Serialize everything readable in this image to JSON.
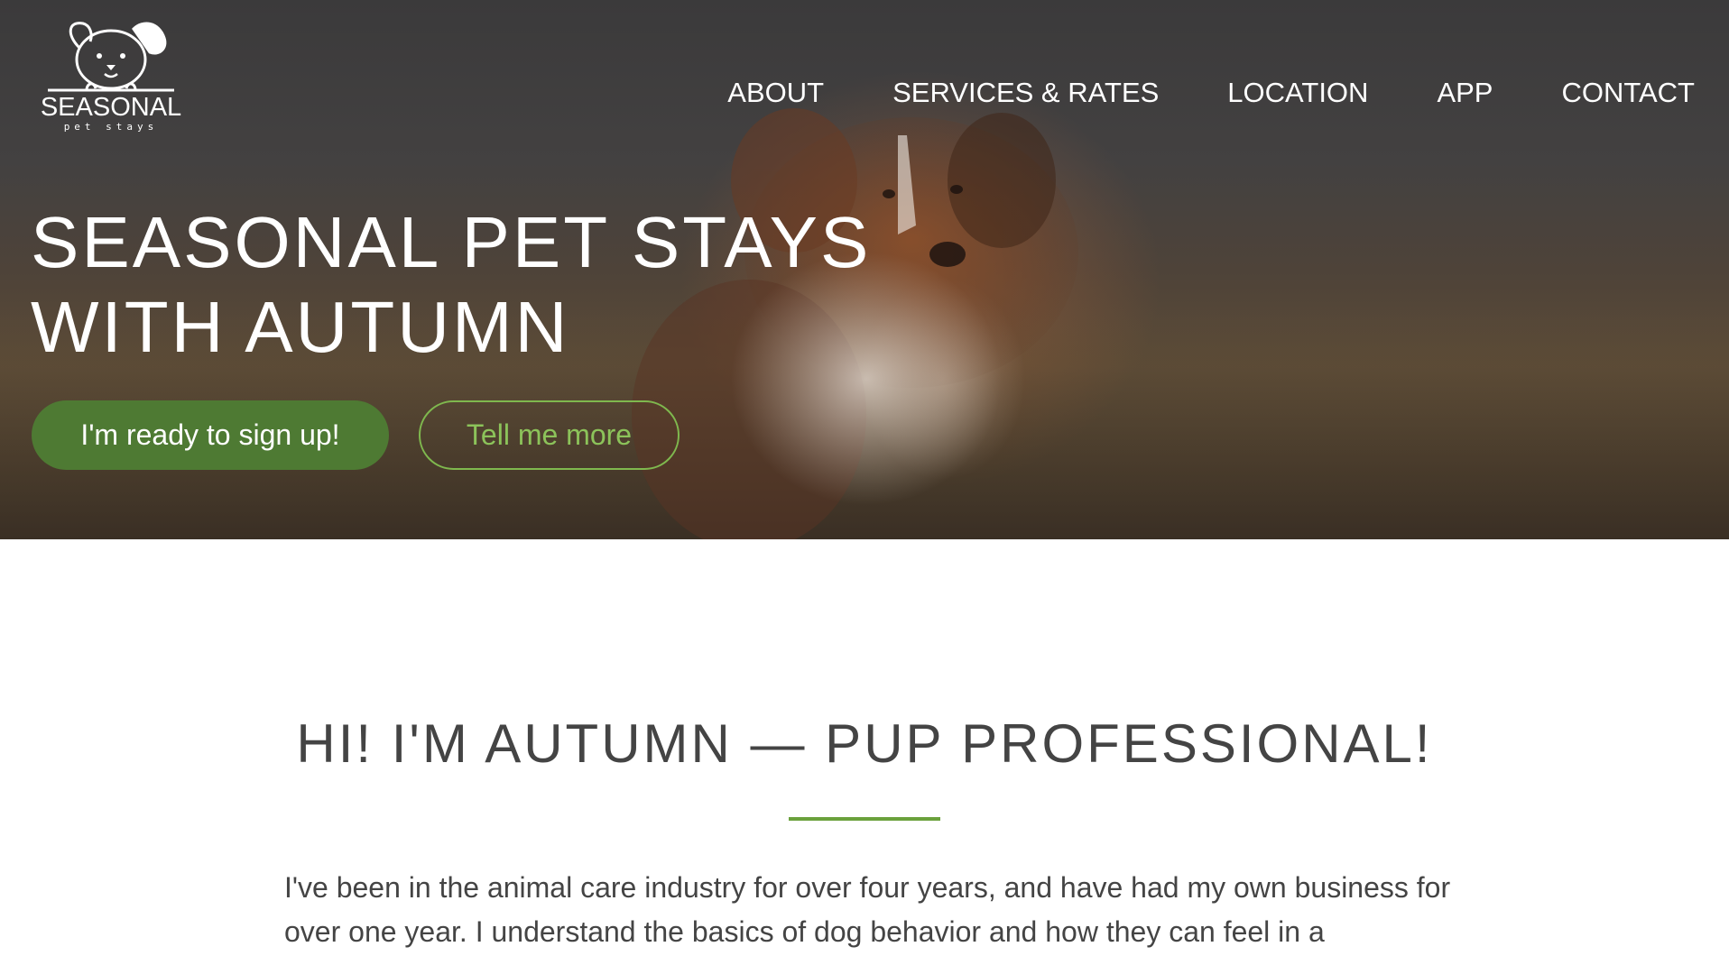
{
  "brand": {
    "name": "SEASONAL",
    "tagline": "pet stays"
  },
  "nav": [
    "ABOUT",
    "SERVICES & RATES",
    "LOCATION",
    "APP",
    "CONTACT"
  ],
  "hero": {
    "title_line1": "SEASONAL PET STAYS",
    "title_line2": "WITH AUTUMN",
    "primary_button": "I'm ready to sign up!",
    "secondary_button": "Tell me more"
  },
  "about": {
    "title": "HI! I'M AUTUMN — PUP PROFESSIONAL!",
    "body": "I've been in the animal care industry for over four years, and have had my own business for over one year. I understand the basics of dog behavior and how they can feel in a"
  },
  "colors": {
    "accent": "#4e7a33",
    "accent_light": "#8cc35a",
    "divider": "#6aa13c",
    "text": "#444444"
  },
  "icons": {
    "logo": "dog-face-icon"
  }
}
